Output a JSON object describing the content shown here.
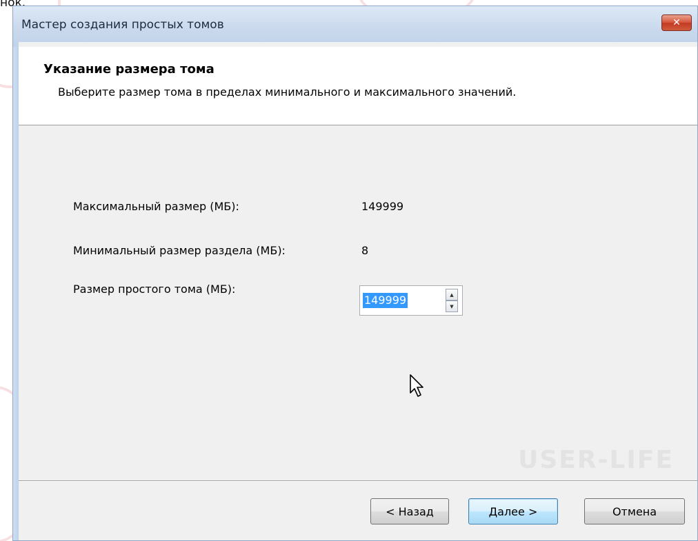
{
  "top_fragment": "нок.",
  "window": {
    "title": "Мастер создания простых томов",
    "close_glyph": "✕"
  },
  "header": {
    "title": "Указание размера тома",
    "subtitle": "Выберите размер тома в пределах минимального и максимального значений."
  },
  "fields": {
    "max_label": "Максимальный размер (МБ):",
    "max_value": "149999",
    "min_label": "Минимальный размер раздела (МБ):",
    "min_value": "8",
    "size_label": "Размер простого тома (МБ):",
    "size_value": "149999"
  },
  "watermark": "USER-LIFE",
  "buttons": {
    "back": "< Назад",
    "next": "Далее >",
    "cancel": "Отмена"
  },
  "colors": {
    "selection": "#3399ff",
    "titlebar": "#cad9ec",
    "close": "#c33b22"
  }
}
